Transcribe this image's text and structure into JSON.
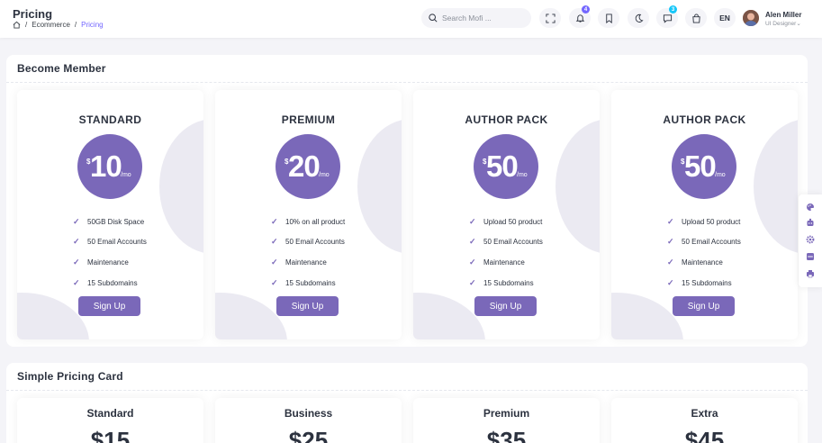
{
  "header": {
    "title": "Pricing",
    "breadcrumb": [
      "Ecommerce",
      "Pricing"
    ],
    "breadcrumb_sep": "/",
    "search_placeholder": "Search Mofi ...",
    "notification_count": "4",
    "cart_count": "3",
    "language": "EN",
    "user": {
      "name": "Alen Miller",
      "role": "UI Designer"
    }
  },
  "become_member": {
    "title": "Become Member",
    "plans": [
      {
        "name": "STANDARD",
        "currency": "$",
        "amount": "10",
        "period": "/mo",
        "features": [
          "50GB Disk Space",
          "50 Email Accounts",
          "Maintenance",
          "15 Subdomains"
        ],
        "button": "Sign Up"
      },
      {
        "name": "PREMIUM",
        "currency": "$",
        "amount": "20",
        "period": "/mo",
        "features": [
          "10% on all product",
          "50 Email Accounts",
          "Maintenance",
          "15 Subdomains"
        ],
        "button": "Sign Up"
      },
      {
        "name": "AUTHOR PACK",
        "currency": "$",
        "amount": "50",
        "period": "/mo",
        "features": [
          "Upload 50 product",
          "50 Email Accounts",
          "Maintenance",
          "15 Subdomains"
        ],
        "button": "Sign Up"
      },
      {
        "name": "AUTHOR PACK",
        "currency": "$",
        "amount": "50",
        "period": "/mo",
        "features": [
          "Upload 50 product",
          "50 Email Accounts",
          "Maintenance",
          "15 Subdomains"
        ],
        "button": "Sign Up"
      }
    ]
  },
  "simple_pricing": {
    "title": "Simple Pricing Card",
    "cards": [
      {
        "name": "Standard",
        "price": "$15"
      },
      {
        "name": "Business",
        "price": "$25"
      },
      {
        "name": "Premium",
        "price": "$35"
      },
      {
        "name": "Extra",
        "price": "$45"
      }
    ]
  },
  "colors": {
    "accent": "#7a68b9",
    "badge": "#7366ff",
    "badge_alt": "#16c7f9",
    "ring": "#ebeaf2"
  }
}
